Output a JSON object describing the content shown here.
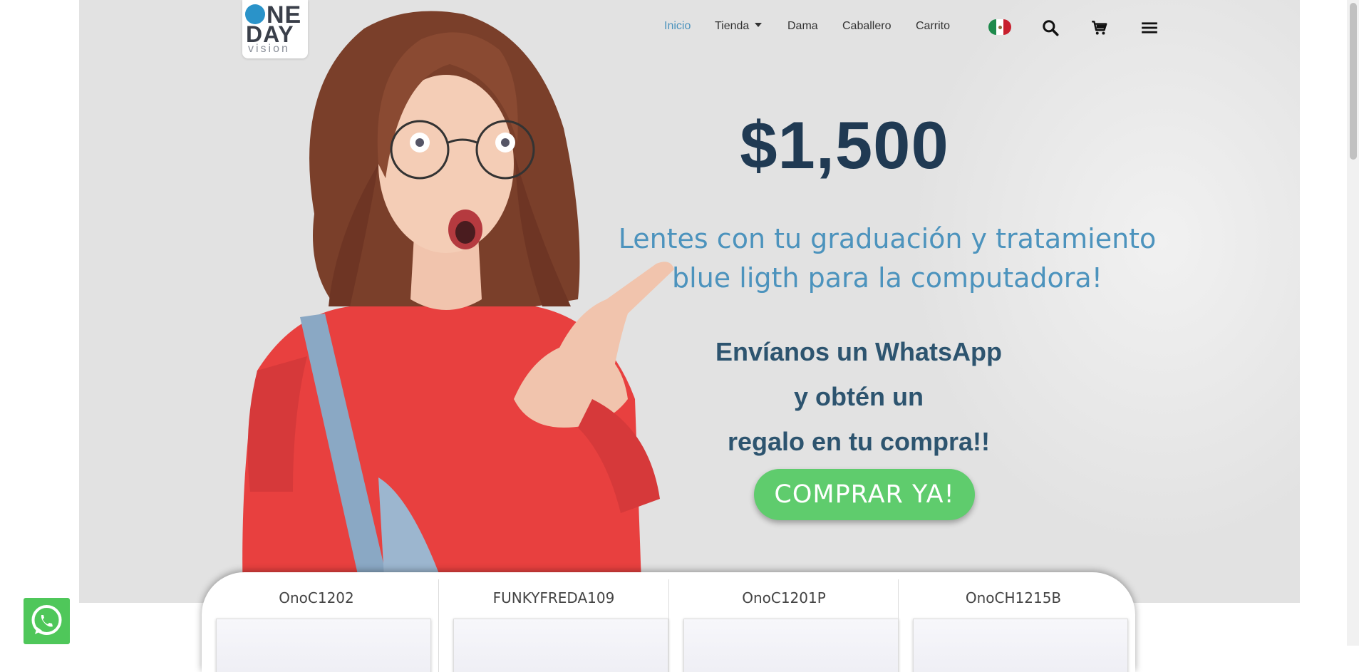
{
  "logo": {
    "line1": "NE",
    "line2": "DAY",
    "line3": "vision"
  },
  "nav": {
    "items": [
      {
        "label": "Inicio",
        "active": true
      },
      {
        "label": "Tienda",
        "has_dropdown": true
      },
      {
        "label": "Dama"
      },
      {
        "label": "Caballero"
      },
      {
        "label": "Carrito"
      }
    ],
    "flag": "mexico-flag-icon",
    "icons": [
      "search-icon",
      "cart-icon",
      "menu-icon"
    ]
  },
  "hero": {
    "price": "$1,500",
    "subtitle_line1": "Lentes con tu graduación y tratamiento",
    "subtitle_line2": "blue ligth para la computadora!",
    "promo_line1": "Envíanos un WhatsApp",
    "promo_line2": "y obtén un",
    "promo_line3": "regalo en tu compra!!",
    "cta_label": "COMPRAR YA!"
  },
  "products": [
    {
      "name": "OnoC1202"
    },
    {
      "name": "FUNKYFREDA109"
    },
    {
      "name": "OnoC1201P"
    },
    {
      "name": "OnoCH1215B"
    }
  ],
  "colors": {
    "hero_bg": "#e2e2e2",
    "price": "#203a53",
    "subtitle": "#4c93bd",
    "promo": "#2d546f",
    "cta": "#5fcc6d",
    "nav_active": "#4c93bd",
    "whatsapp": "#4fc75a"
  },
  "whatsapp": {
    "icon": "whatsapp-icon"
  }
}
